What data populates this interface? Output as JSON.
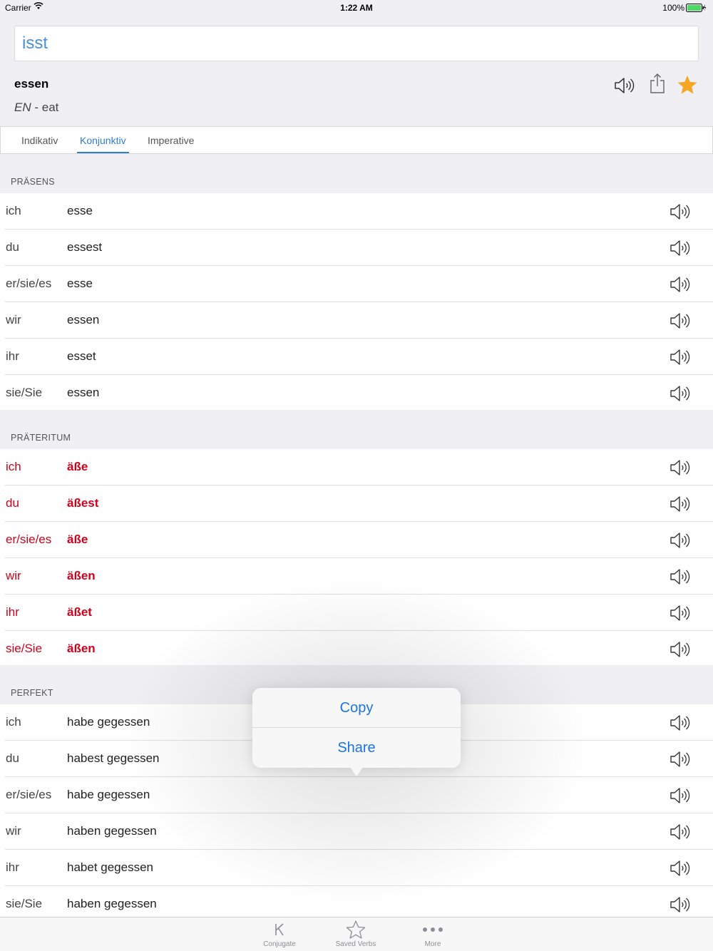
{
  "status": {
    "carrier": "Carrier",
    "time": "1:22 AM",
    "battery": "100%"
  },
  "search": {
    "value": "isst"
  },
  "verb": {
    "infinitive": "essen",
    "lang": "EN",
    "dash": " - ",
    "translation": "eat"
  },
  "tabs": [
    {
      "label": "Indikativ",
      "active": false
    },
    {
      "label": "Konjunktiv",
      "active": true
    },
    {
      "label": "Imperative",
      "active": false
    }
  ],
  "sections": [
    {
      "title": "PRÄSENS",
      "highlight": false,
      "rows": [
        {
          "pronoun": "ich",
          "form": "esse"
        },
        {
          "pronoun": "du",
          "form": "essest"
        },
        {
          "pronoun": "er/sie/es",
          "form": "esse"
        },
        {
          "pronoun": "wir",
          "form": "essen"
        },
        {
          "pronoun": "ihr",
          "form": "esset"
        },
        {
          "pronoun": "sie/Sie",
          "form": "essen"
        }
      ]
    },
    {
      "title": "PRÄTERITUM",
      "highlight": true,
      "rows": [
        {
          "pronoun": "ich",
          "form": "äße"
        },
        {
          "pronoun": "du",
          "form": "äßest"
        },
        {
          "pronoun": "er/sie/es",
          "form": "äße"
        },
        {
          "pronoun": "wir",
          "form": "äßen"
        },
        {
          "pronoun": "ihr",
          "form": "äßet"
        },
        {
          "pronoun": "sie/Sie",
          "form": "äßen"
        }
      ]
    },
    {
      "title": "PERFEKT",
      "highlight": false,
      "rows": [
        {
          "pronoun": "ich",
          "form": "habe gegessen"
        },
        {
          "pronoun": "du",
          "form": "habest gegessen"
        },
        {
          "pronoun": "er/sie/es",
          "form": "habe gegessen"
        },
        {
          "pronoun": "wir",
          "form": "haben gegessen"
        },
        {
          "pronoun": "ihr",
          "form": "habet gegessen"
        },
        {
          "pronoun": "sie/Sie",
          "form": "haben gegessen"
        }
      ]
    }
  ],
  "popover": {
    "copy": "Copy",
    "share": "Share"
  },
  "tabbar": [
    {
      "label": "Conjugate",
      "icon": "k-icon"
    },
    {
      "label": "Saved Verbs",
      "icon": "star-outline-icon"
    },
    {
      "label": "More",
      "icon": "more-dots-icon"
    }
  ],
  "colors": {
    "accent": "#2f7fd1",
    "highlight": "#d0021b",
    "star": "#f5a623"
  }
}
